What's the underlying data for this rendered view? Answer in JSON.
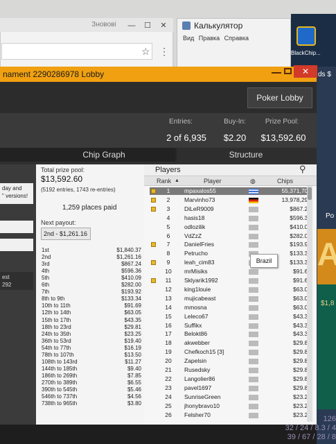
{
  "browser": {
    "tab_label": "Зновові",
    "min": "—",
    "max": "☐",
    "close": "✕"
  },
  "calculator": {
    "title": "Калькулятор",
    "menu": "Вид  Правка  Справка"
  },
  "taskbar": {
    "app_label": "BlackChip..."
  },
  "window": {
    "title": "nament 2290286978 Lobby",
    "close": "✕",
    "poker_lobby_button": "Poker Lobby"
  },
  "stats": {
    "entries_label": "Entries:",
    "entries_value": "2 of 6,935",
    "buyin_label": "Buy-In:",
    "buyin_value": "$2.20",
    "prize_label": "Prize Pool:",
    "prize_value": "$13,592.60"
  },
  "tabs": {
    "chip_graph": "Chip Graph",
    "structure": "Structure"
  },
  "left_edge": {
    "versions_text": "day and\n\" versions!",
    "est": "est",
    "num": "292"
  },
  "prize_panel": {
    "total_label": "Total prize pool:",
    "total_value": "$13,592.60",
    "entries_note": "(5192 entries, 1743 re-entries)",
    "places_paid": "1,259 places paid",
    "next_payout_label": "Next payout:",
    "next_payout_value": "2nd - $1,261.16",
    "payouts": [
      {
        "place": "1st",
        "amount": "$1,840.37"
      },
      {
        "place": "2nd",
        "amount": "$1,261.16"
      },
      {
        "place": "3rd",
        "amount": "$867.24"
      },
      {
        "place": "4th",
        "amount": "$596.36"
      },
      {
        "place": "5th",
        "amount": "$410.09"
      },
      {
        "place": "6th",
        "amount": "$282.00"
      },
      {
        "place": "7th",
        "amount": "$193.92"
      },
      {
        "place": "8th to 9th",
        "amount": "$133.34"
      },
      {
        "place": "10th to 11th",
        "amount": "$91.69"
      },
      {
        "place": "12th to 14th",
        "amount": "$63.05"
      },
      {
        "place": "15th to 17th",
        "amount": "$43.35"
      },
      {
        "place": "18th to 23rd",
        "amount": "$29.81"
      },
      {
        "place": "24th to 35th",
        "amount": "$23.25"
      },
      {
        "place": "36th to 53rd",
        "amount": "$19.40"
      },
      {
        "place": "54th to 77th",
        "amount": "$16.19"
      },
      {
        "place": "78th to 107th",
        "amount": "$13.50"
      },
      {
        "place": "108th to 143rd",
        "amount": "$11.27"
      },
      {
        "place": "144th to 185th",
        "amount": "$9.40"
      },
      {
        "place": "186th to 269th",
        "amount": "$7.85"
      },
      {
        "place": "270th to 389th",
        "amount": "$6.55"
      },
      {
        "place": "390th to 545th",
        "amount": "$5.46"
      },
      {
        "place": "546th to 737th",
        "amount": "$4.56"
      },
      {
        "place": "738th to 965th",
        "amount": "$3.80"
      }
    ]
  },
  "players_panel": {
    "title": "Players",
    "col_rank": "Rank",
    "col_player": "Player",
    "col_chips": "Chips",
    "tooltip": "Brazil",
    "rows": [
      {
        "rank": "1",
        "name": "mpaxalos55",
        "chips": "55,371,708",
        "mark": true
      },
      {
        "rank": "2",
        "name": "Marvinho73",
        "chips": "13,978,292",
        "mark": true
      },
      {
        "rank": "3",
        "name": "DiLeR9009",
        "chips": "$867.24",
        "mark": true
      },
      {
        "rank": "4",
        "name": "hasis18",
        "chips": "$596.36",
        "mark": false
      },
      {
        "rank": "5",
        "name": "odlozilik",
        "chips": "$410.09",
        "mark": false
      },
      {
        "rank": "6",
        "name": "VdZzZ",
        "chips": "$282.00",
        "mark": false
      },
      {
        "rank": "7",
        "name": "DanielFries",
        "chips": "$193.92",
        "mark": true
      },
      {
        "rank": "8",
        "name": "Petrucho",
        "chips": "$133.34",
        "mark": false
      },
      {
        "rank": "9",
        "name": "leah_cim83",
        "chips": "$133.34",
        "mark": true
      },
      {
        "rank": "10",
        "name": "mrMisiks",
        "chips": "$91.69",
        "mark": false
      },
      {
        "rank": "11",
        "name": "Sklyarik1992",
        "chips": "$91.69",
        "mark": true
      },
      {
        "rank": "12",
        "name": "king1louie",
        "chips": "$63.05",
        "mark": false
      },
      {
        "rank": "13",
        "name": "mujicabeast",
        "chips": "$63.05",
        "mark": false
      },
      {
        "rank": "14",
        "name": "mmosna",
        "chips": "$63.05",
        "mark": false
      },
      {
        "rank": "15",
        "name": "Leleco67",
        "chips": "$43.35",
        "mark": false
      },
      {
        "rank": "16",
        "name": "Suffikx",
        "chips": "$43.35",
        "mark": false
      },
      {
        "rank": "17",
        "name": "Belokt86",
        "chips": "$43.35",
        "mark": false
      },
      {
        "rank": "18",
        "name": "akwebber",
        "chips": "$29.81",
        "mark": false
      },
      {
        "rank": "19",
        "name": "Chefkoch15 [3]",
        "chips": "$29.81",
        "mark": false
      },
      {
        "rank": "20",
        "name": "Zapelsin",
        "chips": "$29.81",
        "mark": false
      },
      {
        "rank": "21",
        "name": "Rusedsky",
        "chips": "$29.81",
        "mark": false
      },
      {
        "rank": "22",
        "name": "Langolier86",
        "chips": "$29.81",
        "mark": false
      },
      {
        "rank": "23",
        "name": "pavel1697",
        "chips": "$29.81",
        "mark": false
      },
      {
        "rank": "24",
        "name": "SunriseGreen",
        "chips": "$23.25",
        "mark": false
      },
      {
        "rank": "25",
        "name": "jhonybravo10",
        "chips": "$23.25",
        "mark": false
      },
      {
        "rank": "26",
        "name": "Felsher70",
        "chips": "$23.25",
        "mark": false
      }
    ]
  },
  "right_strip": {
    "po": "Po",
    "big_letter": "A",
    "amount": "$1,8",
    "side_text": "ds $"
  },
  "bottom_numbers": [
    "126",
    "32 / 24 / 8.3 / 4",
    "39 / 67 / 28 / 8"
  ],
  "colors": {
    "title_orange": "#f0a011",
    "close_red": "#d23a2a",
    "selected_row": "#7a7a7a"
  }
}
